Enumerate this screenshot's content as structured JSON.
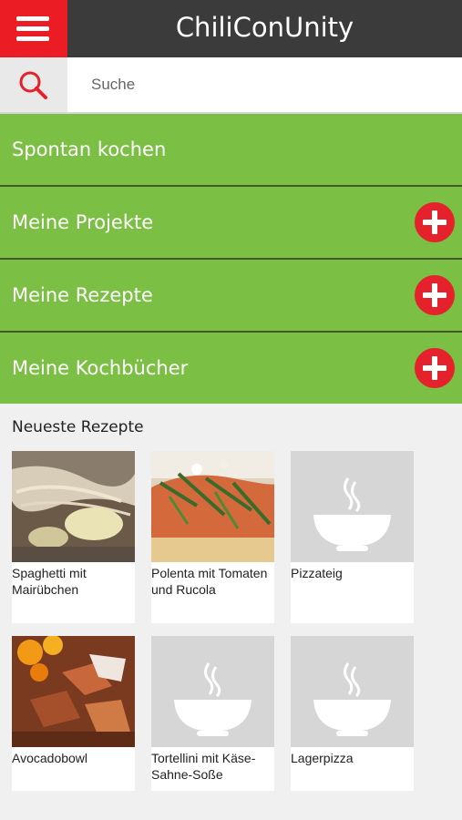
{
  "app": {
    "title": "ChiliConUnity"
  },
  "search": {
    "placeholder": "Suche",
    "value": ""
  },
  "nav": {
    "items": [
      {
        "label": "Spontan kochen",
        "has_add": false
      },
      {
        "label": "Meine Projekte",
        "has_add": true
      },
      {
        "label": "Meine Rezepte",
        "has_add": true
      },
      {
        "label": "Meine Kochbücher",
        "has_add": true
      }
    ]
  },
  "recipes": {
    "title": "Neueste Rezepte",
    "items": [
      {
        "name": "Spaghetti mit Mairübchen",
        "image": "photo"
      },
      {
        "name": "Polenta mit Tomaten und Rucola",
        "image": "photo"
      },
      {
        "name": "Pizzateig",
        "image": "placeholder-bowl-icon"
      },
      {
        "name": "Avocadobowl",
        "image": "photo"
      },
      {
        "name": "Tortellini mit Käse-Sahne-Soße",
        "image": "placeholder-bowl-icon"
      },
      {
        "name": "Lagerpizza",
        "image": "placeholder-bowl-icon"
      }
    ]
  },
  "colors": {
    "header": "#3b3b3b",
    "accent_red": "#ec1c24",
    "nav_green": "#7cbf45",
    "add_red": "#e5212b"
  }
}
